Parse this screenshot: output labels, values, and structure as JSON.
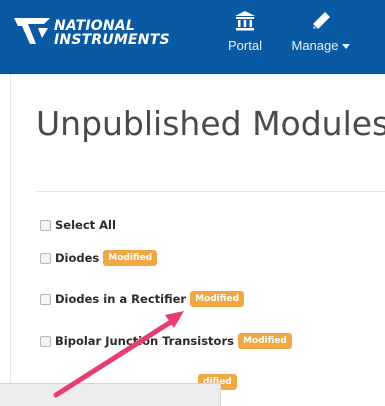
{
  "navbar": {
    "logo_line1": "NATIONAL",
    "logo_line2": "INSTRUMENTS",
    "portal_label": "Portal",
    "manage_label": "Manage",
    "portal_icon": "institution-icon",
    "manage_icon": "pencil-icon",
    "background_color": "#0a5aa3"
  },
  "main": {
    "title": "Unpublished Modules",
    "select_all_label": "Select All",
    "modules": [
      {
        "name": "Diodes",
        "badge": "Modified"
      },
      {
        "name": "Diodes in a Rectifier",
        "badge": "Modified"
      },
      {
        "name": "Bipolar Junction Transistors",
        "badge": "Modified"
      },
      {
        "name": "",
        "badge": "dified"
      }
    ]
  },
  "colors": {
    "badge": "#f0a844",
    "annotation_arrow": "#e83e6f"
  }
}
